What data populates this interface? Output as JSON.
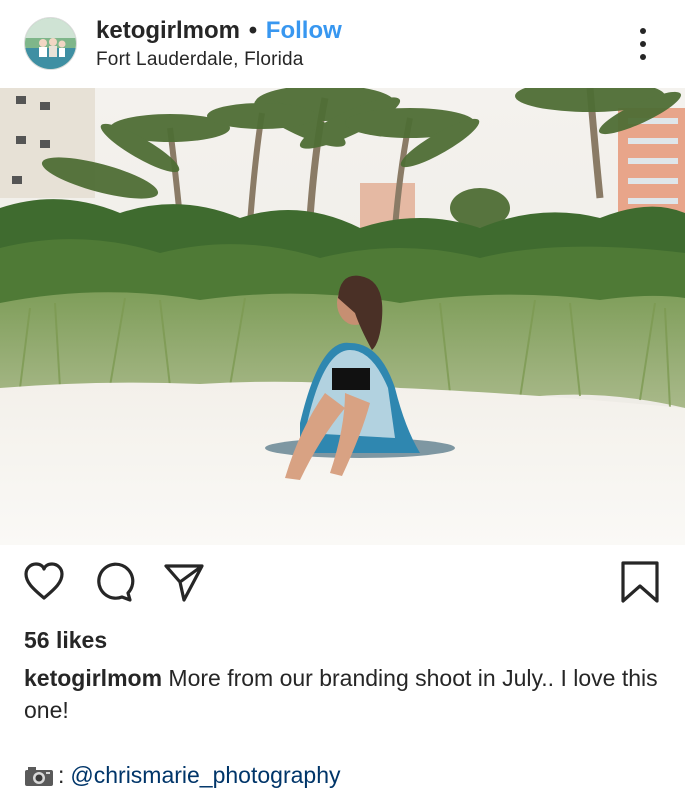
{
  "header": {
    "username": "ketogirlmom",
    "separator": "•",
    "follow_label": "Follow",
    "location": "Fort Lauderdale, Florida"
  },
  "actions": {
    "like_icon": "heart-icon",
    "comment_icon": "comment-icon",
    "share_icon": "paper-plane-icon",
    "save_icon": "bookmark-icon"
  },
  "likes": "56 likes",
  "caption": {
    "username": "ketogirlmom",
    "text": "More from our branding shoot in July.. I love this one!"
  },
  "credit": {
    "emoji": "📷",
    "separator": ":",
    "mention": "@chrismarie_photography"
  },
  "colors": {
    "follow": "#3897f0",
    "mention": "#003569",
    "text": "#262626"
  }
}
